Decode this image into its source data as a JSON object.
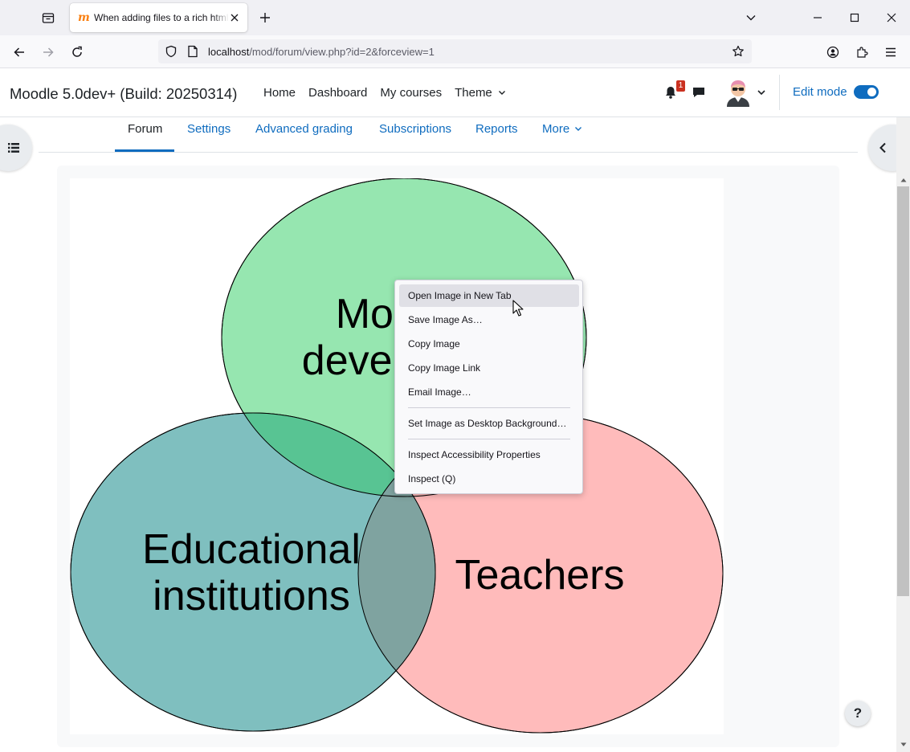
{
  "browser": {
    "tab_title": "When adding files to a rich html",
    "tab_favicon": "m",
    "url_host": "localhost",
    "url_path": "/mod/forum/view.php?id=2&forceview=1",
    "icons": [
      "tab-list-icon",
      "close-icon",
      "plus-icon",
      "chevron-down-icon",
      "minimize-icon",
      "maximize-icon",
      "close-window-icon",
      "back-arrow-icon",
      "forward-arrow-icon",
      "reload-icon",
      "shield-icon",
      "page-icon",
      "star-icon",
      "account-icon",
      "extensions-icon",
      "menu-icon"
    ]
  },
  "header": {
    "site_name": "Moodle 5.0dev+ (Build: 20250314)",
    "nav": [
      "Home",
      "Dashboard",
      "My courses",
      "Theme"
    ],
    "notification_count": "1",
    "edit_mode_label": "Edit mode",
    "edit_mode_on": true
  },
  "secondary_nav": {
    "items": [
      "Forum",
      "Settings",
      "Advanced grading",
      "Subscriptions",
      "Reports",
      "More"
    ],
    "active": "Forum"
  },
  "venn": {
    "labels": {
      "top_line1": "Moodle",
      "top_line2": "developers",
      "left_line1": "Educational",
      "left_line2": "institutions",
      "right": "Teachers"
    },
    "colors": {
      "top": "#8ee0a8",
      "left": "#5fa8a8",
      "right": "#ffaaaa"
    }
  },
  "context_menu": {
    "items": [
      "Open Image in New Tab",
      "Save Image As…",
      "Copy Image",
      "Copy Image Link",
      "Email Image…",
      "Set Image as Desktop Background…",
      "Inspect Accessibility Properties",
      "Inspect (Q)"
    ],
    "hovered": "Open Image in New Tab"
  },
  "help_button": "?",
  "colors": {
    "brand_link": "#0f6cbf",
    "badge": "#ca3120"
  }
}
